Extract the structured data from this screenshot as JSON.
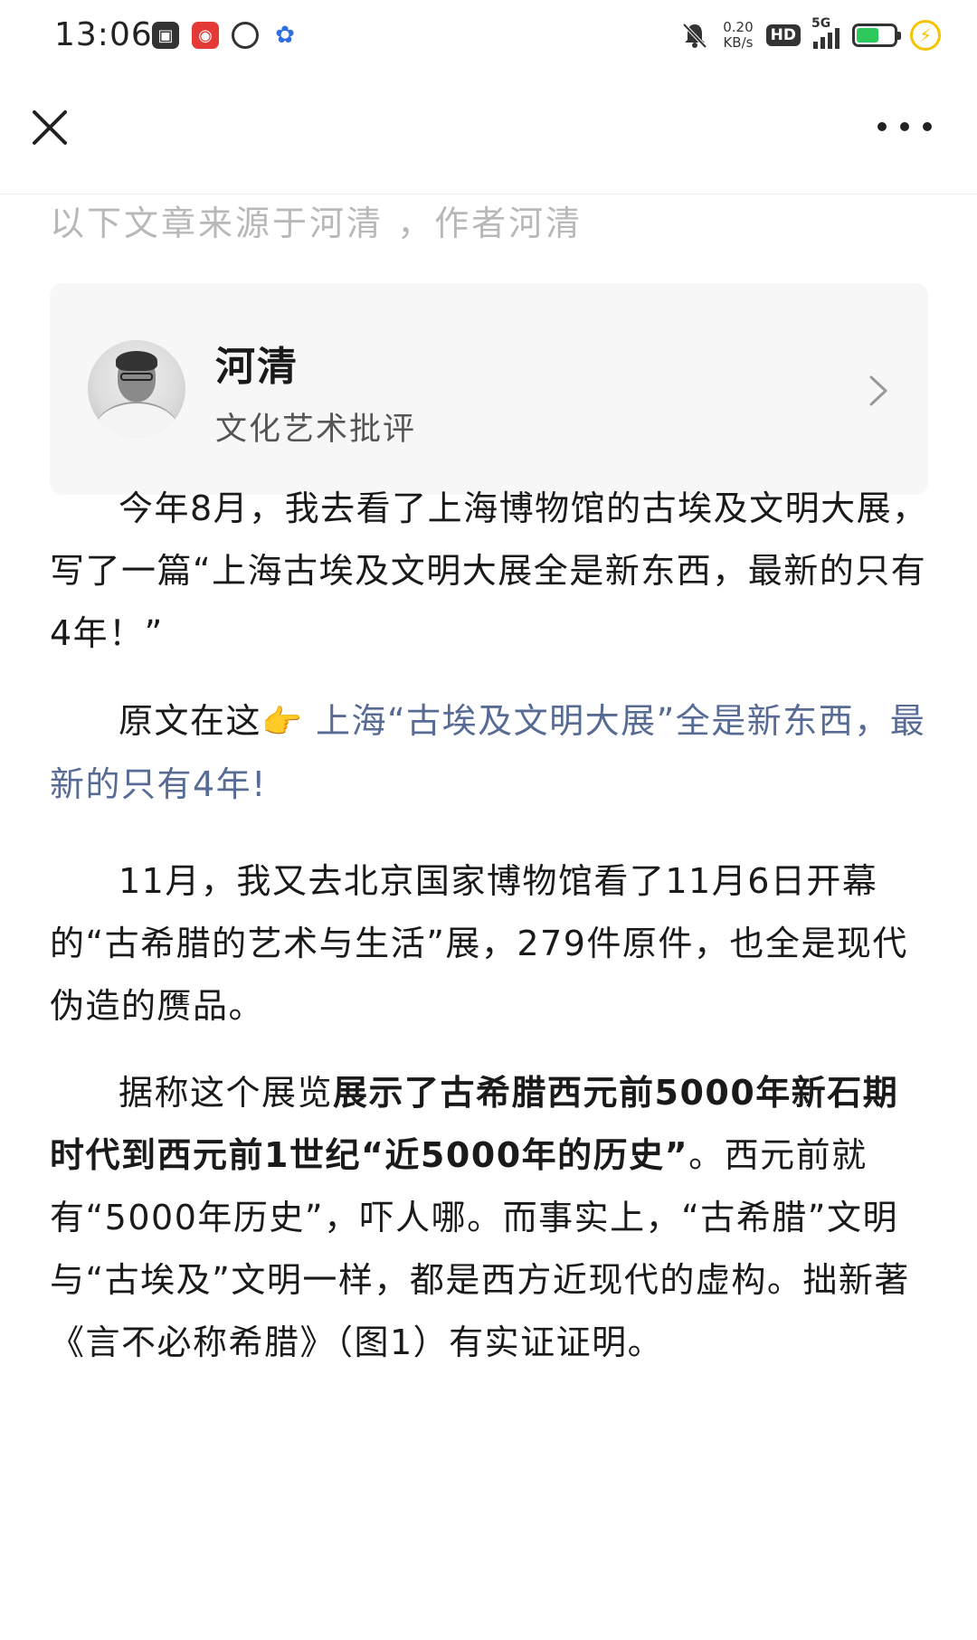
{
  "status_bar": {
    "time": "13:06",
    "net_speed_value": "0.20",
    "net_speed_unit": "KB/s",
    "hd_label": "HD",
    "signal_label": "5G",
    "battery_level": 0.6
  },
  "nav": {
    "close_icon": "close-icon",
    "more_icon": "more-dots-icon"
  },
  "source_note": "以下文章来源于河清 ，作者河清",
  "author": {
    "name": "河清",
    "description": "文化艺术批评"
  },
  "paragraphs": {
    "p1": "今年8月，我去看了上海博物馆的古埃及文明大展，写了一篇“上海古埃及文明大展全是新东西，最新的只有4年！”",
    "p2_prefix": "原文在这",
    "p2_emoji": "👉",
    "p2_link": "上海“古埃及文明大展”全是新东西，最新的只有4年!",
    "p3": "11月，我又去北京国家博物馆看了11月6日开幕的“古希腊的艺术与生活”展，279件原件，也全是现代伪造的赝品。",
    "p4_prefix": "据称这个展览",
    "p4_bold": "展示了古希腊西元前5000年新石期时代到西元前1世纪“近5000年的历史”",
    "p4_suffix": "。西元前就有“5000年历史”，吓人哪。而事实上，“古希腊”文明与“古埃及”文明一样，都是西方近现代的虚构。拙新著《言不必称希腊》（图1）有实证证明。"
  },
  "colors": {
    "link": "#576b95",
    "muted": "#b8b8b8",
    "card_bg": "#f7f7f7",
    "battery_green": "#2ec95c"
  }
}
